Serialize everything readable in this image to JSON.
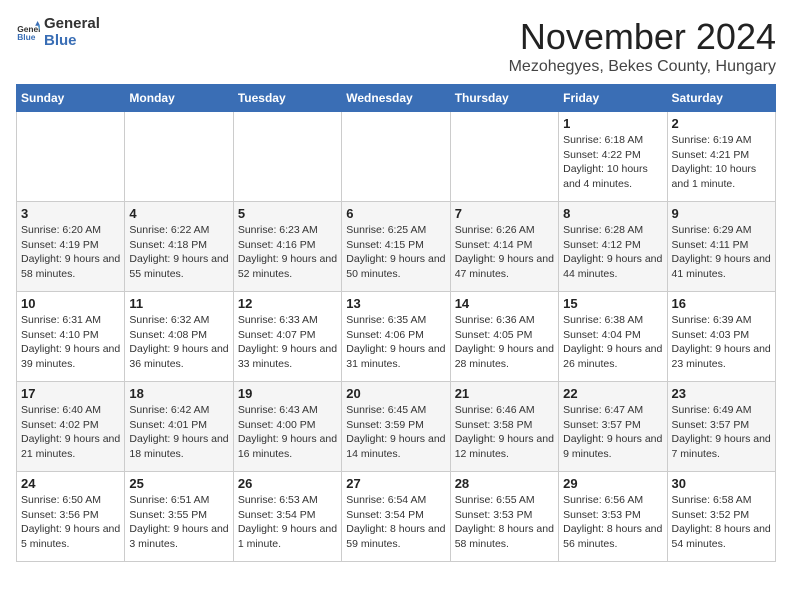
{
  "logo": {
    "general": "General",
    "blue": "Blue"
  },
  "header": {
    "month": "November 2024",
    "location": "Mezohegyes, Bekes County, Hungary"
  },
  "weekdays": [
    "Sunday",
    "Monday",
    "Tuesday",
    "Wednesday",
    "Thursday",
    "Friday",
    "Saturday"
  ],
  "weeks": [
    [
      {
        "day": "",
        "info": ""
      },
      {
        "day": "",
        "info": ""
      },
      {
        "day": "",
        "info": ""
      },
      {
        "day": "",
        "info": ""
      },
      {
        "day": "",
        "info": ""
      },
      {
        "day": "1",
        "info": "Sunrise: 6:18 AM\nSunset: 4:22 PM\nDaylight: 10 hours and 4 minutes."
      },
      {
        "day": "2",
        "info": "Sunrise: 6:19 AM\nSunset: 4:21 PM\nDaylight: 10 hours and 1 minute."
      }
    ],
    [
      {
        "day": "3",
        "info": "Sunrise: 6:20 AM\nSunset: 4:19 PM\nDaylight: 9 hours and 58 minutes."
      },
      {
        "day": "4",
        "info": "Sunrise: 6:22 AM\nSunset: 4:18 PM\nDaylight: 9 hours and 55 minutes."
      },
      {
        "day": "5",
        "info": "Sunrise: 6:23 AM\nSunset: 4:16 PM\nDaylight: 9 hours and 52 minutes."
      },
      {
        "day": "6",
        "info": "Sunrise: 6:25 AM\nSunset: 4:15 PM\nDaylight: 9 hours and 50 minutes."
      },
      {
        "day": "7",
        "info": "Sunrise: 6:26 AM\nSunset: 4:14 PM\nDaylight: 9 hours and 47 minutes."
      },
      {
        "day": "8",
        "info": "Sunrise: 6:28 AM\nSunset: 4:12 PM\nDaylight: 9 hours and 44 minutes."
      },
      {
        "day": "9",
        "info": "Sunrise: 6:29 AM\nSunset: 4:11 PM\nDaylight: 9 hours and 41 minutes."
      }
    ],
    [
      {
        "day": "10",
        "info": "Sunrise: 6:31 AM\nSunset: 4:10 PM\nDaylight: 9 hours and 39 minutes."
      },
      {
        "day": "11",
        "info": "Sunrise: 6:32 AM\nSunset: 4:08 PM\nDaylight: 9 hours and 36 minutes."
      },
      {
        "day": "12",
        "info": "Sunrise: 6:33 AM\nSunset: 4:07 PM\nDaylight: 9 hours and 33 minutes."
      },
      {
        "day": "13",
        "info": "Sunrise: 6:35 AM\nSunset: 4:06 PM\nDaylight: 9 hours and 31 minutes."
      },
      {
        "day": "14",
        "info": "Sunrise: 6:36 AM\nSunset: 4:05 PM\nDaylight: 9 hours and 28 minutes."
      },
      {
        "day": "15",
        "info": "Sunrise: 6:38 AM\nSunset: 4:04 PM\nDaylight: 9 hours and 26 minutes."
      },
      {
        "day": "16",
        "info": "Sunrise: 6:39 AM\nSunset: 4:03 PM\nDaylight: 9 hours and 23 minutes."
      }
    ],
    [
      {
        "day": "17",
        "info": "Sunrise: 6:40 AM\nSunset: 4:02 PM\nDaylight: 9 hours and 21 minutes."
      },
      {
        "day": "18",
        "info": "Sunrise: 6:42 AM\nSunset: 4:01 PM\nDaylight: 9 hours and 18 minutes."
      },
      {
        "day": "19",
        "info": "Sunrise: 6:43 AM\nSunset: 4:00 PM\nDaylight: 9 hours and 16 minutes."
      },
      {
        "day": "20",
        "info": "Sunrise: 6:45 AM\nSunset: 3:59 PM\nDaylight: 9 hours and 14 minutes."
      },
      {
        "day": "21",
        "info": "Sunrise: 6:46 AM\nSunset: 3:58 PM\nDaylight: 9 hours and 12 minutes."
      },
      {
        "day": "22",
        "info": "Sunrise: 6:47 AM\nSunset: 3:57 PM\nDaylight: 9 hours and 9 minutes."
      },
      {
        "day": "23",
        "info": "Sunrise: 6:49 AM\nSunset: 3:57 PM\nDaylight: 9 hours and 7 minutes."
      }
    ],
    [
      {
        "day": "24",
        "info": "Sunrise: 6:50 AM\nSunset: 3:56 PM\nDaylight: 9 hours and 5 minutes."
      },
      {
        "day": "25",
        "info": "Sunrise: 6:51 AM\nSunset: 3:55 PM\nDaylight: 9 hours and 3 minutes."
      },
      {
        "day": "26",
        "info": "Sunrise: 6:53 AM\nSunset: 3:54 PM\nDaylight: 9 hours and 1 minute."
      },
      {
        "day": "27",
        "info": "Sunrise: 6:54 AM\nSunset: 3:54 PM\nDaylight: 8 hours and 59 minutes."
      },
      {
        "day": "28",
        "info": "Sunrise: 6:55 AM\nSunset: 3:53 PM\nDaylight: 8 hours and 58 minutes."
      },
      {
        "day": "29",
        "info": "Sunrise: 6:56 AM\nSunset: 3:53 PM\nDaylight: 8 hours and 56 minutes."
      },
      {
        "day": "30",
        "info": "Sunrise: 6:58 AM\nSunset: 3:52 PM\nDaylight: 8 hours and 54 minutes."
      }
    ]
  ]
}
